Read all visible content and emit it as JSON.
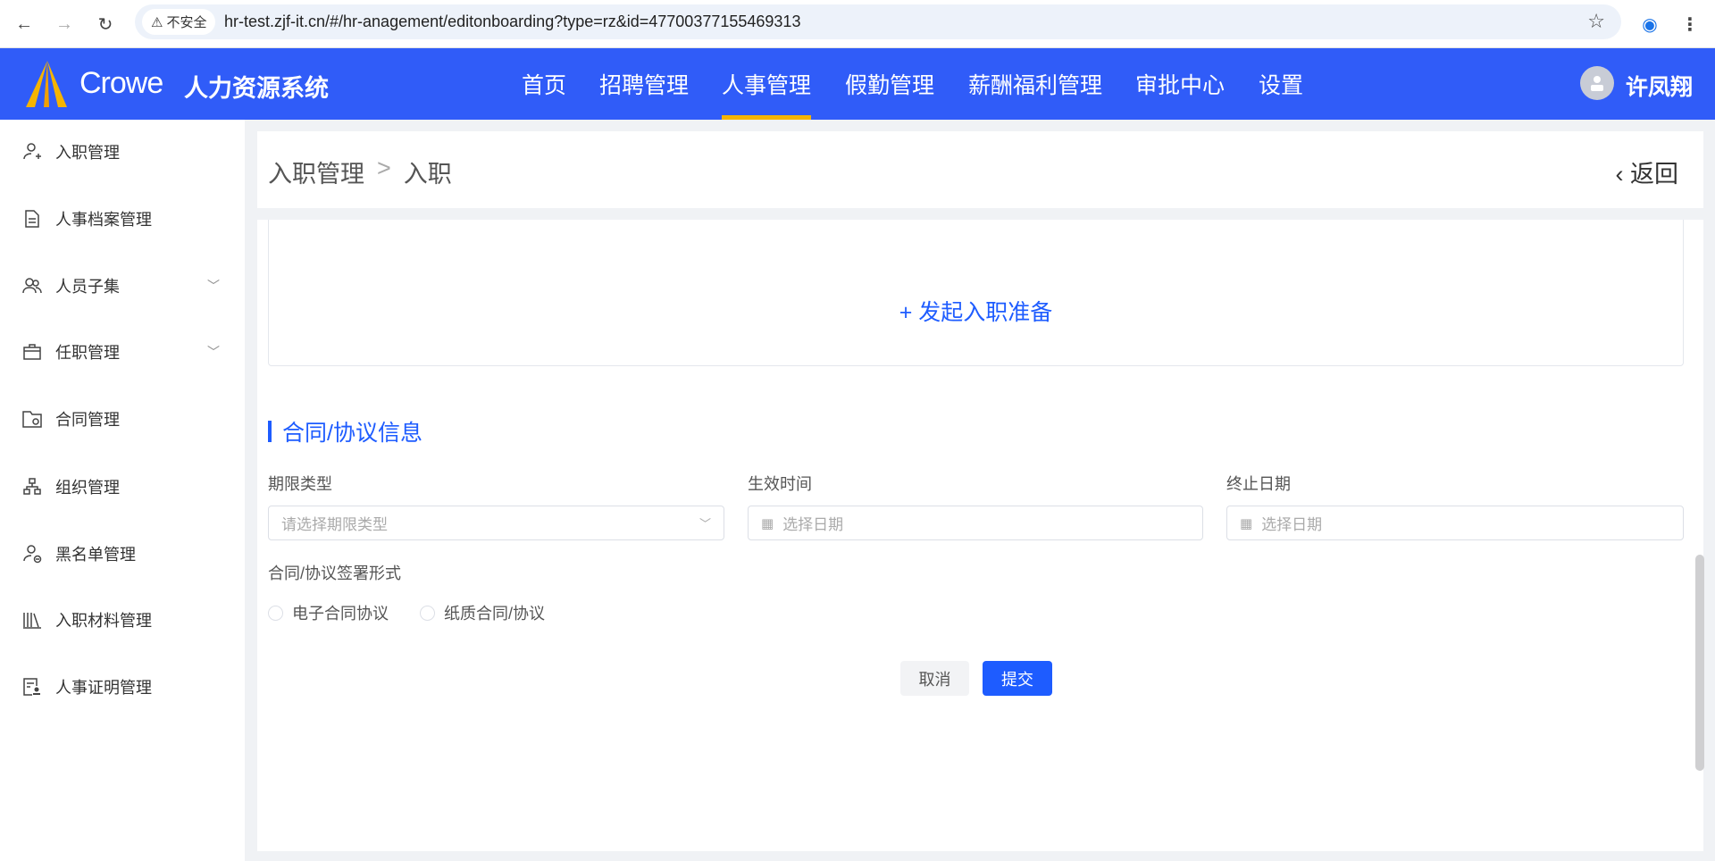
{
  "browser": {
    "security_label": "不安全",
    "url": "hr-test.zjf-it.cn/#/hr-anagement/editonboarding?type=rz&id=47700377155469313"
  },
  "header": {
    "brand": "Crowe",
    "system_title": "人力资源系统",
    "nav": [
      "首页",
      "招聘管理",
      "人事管理",
      "假勤管理",
      "薪酬福利管理",
      "审批中心",
      "设置"
    ],
    "active_nav": "人事管理",
    "user_name": "许凤翔",
    "accent": "#305cf8"
  },
  "sidebar": {
    "items": [
      {
        "label": "入职管理"
      },
      {
        "label": "人事档案管理"
      },
      {
        "label": "人员子集"
      },
      {
        "label": "任职管理"
      },
      {
        "label": "合同管理"
      },
      {
        "label": "组织管理"
      },
      {
        "label": "黑名单管理"
      },
      {
        "label": "入职材料管理"
      },
      {
        "label": "人事证明管理"
      }
    ]
  },
  "breadcrumb": {
    "parent": "入职管理",
    "separator": ">",
    "current": "入职",
    "back": "返回"
  },
  "prep": {
    "label": "+ 发起入职准备"
  },
  "contract": {
    "title": "合同/协议信息",
    "term_type": {
      "label": "期限类型",
      "placeholder": "请选择期限类型"
    },
    "start": {
      "label": "生效时间",
      "placeholder": "选择日期"
    },
    "end": {
      "label": "终止日期",
      "placeholder": "选择日期"
    },
    "sign_form": {
      "label": "合同/协议签署形式",
      "options": [
        "电子合同协议",
        "纸质合同/协议"
      ]
    }
  },
  "actions": {
    "cancel": "取消",
    "submit": "提交"
  }
}
